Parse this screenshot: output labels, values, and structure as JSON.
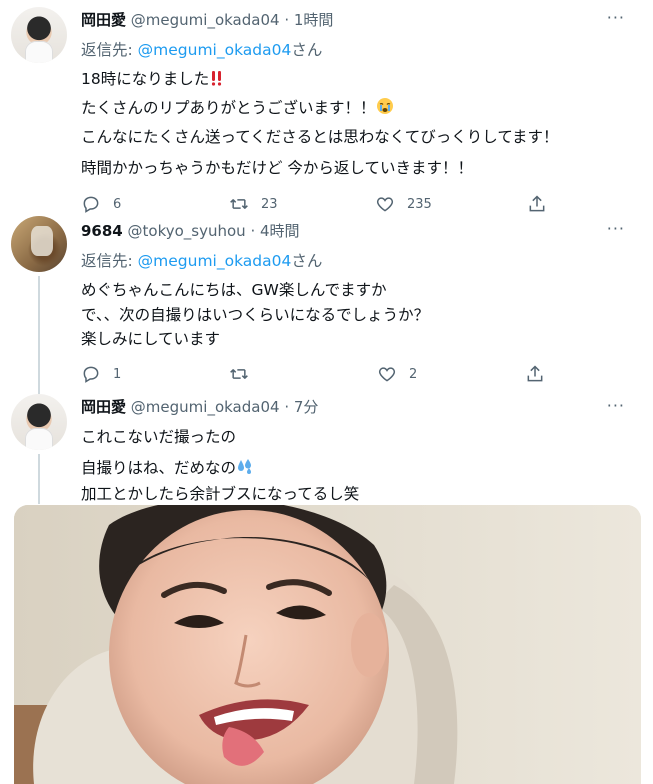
{
  "tweets": [
    {
      "name": "岡田愛",
      "handle": "@megumi_okada04",
      "time": "· 1時間",
      "reply_prefix": "返信先: ",
      "reply_handle": "@megumi_okada04",
      "reply_suffix": "さん",
      "lines": [
        "18時になりました",
        "たくさんのリプありがとうございます！！",
        "こんなにたくさん送ってくださるとは思わなくてびっくりしてます！",
        "時間かかっちゃうかもだけど 今から返していきます！！"
      ],
      "replies": "6",
      "retweets": "23",
      "likes": "235"
    },
    {
      "name": "9684",
      "handle": "@tokyo_syuhou",
      "time": "· 4時間",
      "reply_prefix": "返信先: ",
      "reply_handle": "@megumi_okada04",
      "reply_suffix": "さん",
      "lines": [
        "めぐちゃんこんにちは、GW楽しんでますか",
        "で、、次の自撮りはいつくらいになるでしょうか？",
        "楽しみにしています"
      ],
      "replies": "1",
      "retweets": "",
      "likes": "2"
    },
    {
      "name": "岡田愛",
      "handle": "@megumi_okada04",
      "time": "· 7分",
      "lines": [
        "これこないだ撮ったの",
        "自撮りはね、だめなの",
        "加工とかしたら余計ブスになってるし笑"
      ]
    }
  ],
  "more_glyph": "···",
  "icons": [
    "more-icon",
    "reply-icon",
    "retweet-icon",
    "like-icon",
    "share-icon",
    "double-exclamation-emoji",
    "crying-face-emoji",
    "sweat-droplets-emoji"
  ],
  "colors": {
    "link": "#1d9bf0",
    "secondary": "#536471",
    "text": "#0f1419",
    "thread_line": "#cfd9de"
  }
}
